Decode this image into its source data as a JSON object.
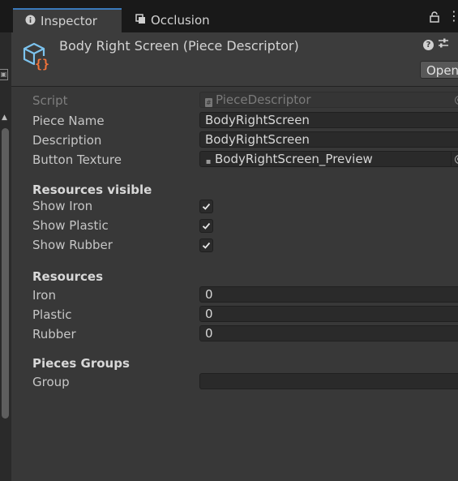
{
  "tabs": [
    {
      "label": "Inspector",
      "icon": "info-icon"
    },
    {
      "label": "Occlusion",
      "icon": "occlusion-icon"
    }
  ],
  "header": {
    "title": "Body Right Screen (Piece Descriptor)",
    "icon": "script-cube-icon",
    "open_label": "Open"
  },
  "fields": {
    "script": {
      "label": "Script",
      "value": "PieceDescriptor"
    },
    "piece_name": {
      "label": "Piece Name",
      "value": "BodyRightScreen"
    },
    "description": {
      "label": "Description",
      "value": "BodyRightScreen"
    },
    "button_texture": {
      "label": "Button Texture",
      "value": "BodyRightScreen_Preview"
    }
  },
  "resources_visible": {
    "title": "Resources visible",
    "items": [
      {
        "label": "Show Iron",
        "checked": true
      },
      {
        "label": "Show Plastic",
        "checked": true
      },
      {
        "label": "Show Rubber",
        "checked": true
      }
    ]
  },
  "resources": {
    "title": "Resources",
    "items": [
      {
        "label": "Iron",
        "value": "0"
      },
      {
        "label": "Plastic",
        "value": "0"
      },
      {
        "label": "Rubber",
        "value": "0"
      }
    ]
  },
  "pieces_groups": {
    "title": "Pieces Groups",
    "group_label": "Group",
    "group_value": ""
  },
  "colors": {
    "accent": "#3a79bb",
    "icon_blue": "#7cc3ee",
    "icon_orange": "#f2733a"
  }
}
